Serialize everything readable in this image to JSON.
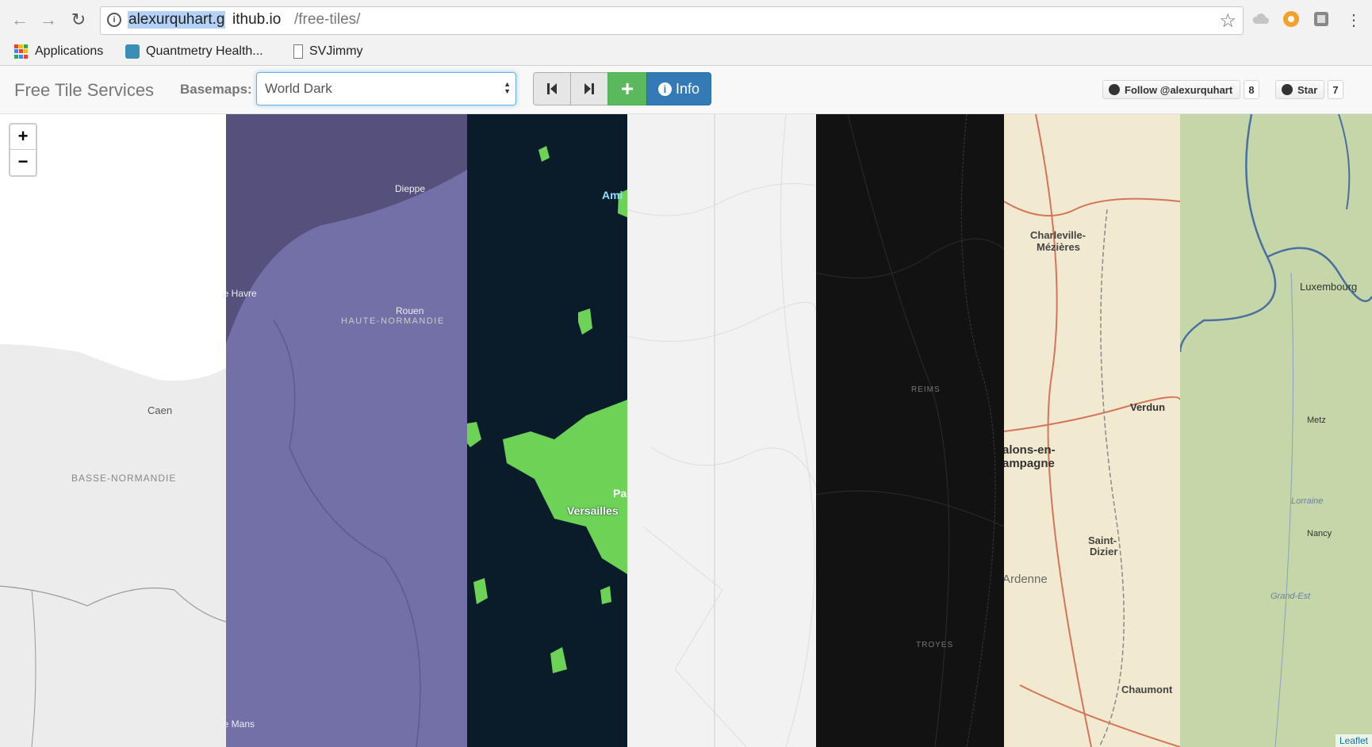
{
  "browser": {
    "url_host_highlight": "alexurquhart.g",
    "url_host_rest": "ithub.io",
    "url_path": "/free-tiles/",
    "bookmarks": [
      {
        "label": "Applications"
      },
      {
        "label": "Quantmetry Health..."
      },
      {
        "label": "SVJimmy"
      }
    ]
  },
  "header": {
    "title": "Free Tile Services",
    "basemaps_label": "Basemaps:",
    "basemap_selected": "World Dark",
    "info_label": "Info",
    "follow_label": "Follow @alexurquhart",
    "follow_count": "8",
    "star_label": "Star",
    "star_count": "7"
  },
  "map": {
    "zoom_in": "+",
    "zoom_out": "−",
    "attribution": "Leaflet",
    "strip1": {
      "labels": [
        "Caen",
        "BASSE-NORMANDIE"
      ]
    },
    "strip2": {
      "labels": [
        "Dieppe",
        "Le Havre",
        "Rouen",
        "HAUTE-NORMANDIE",
        "Le Mans"
      ]
    },
    "strip3": {
      "labels": [
        "Ami",
        "Versailles",
        "Pa"
      ]
    },
    "strip5": {
      "labels": [
        "REIMS",
        "TROYES"
      ]
    },
    "strip6": {
      "labels": [
        "Charleville-",
        "Mézières",
        "Verdun",
        "alons-en-",
        "ampagne",
        "Saint-",
        "Dizier",
        "Ardenne",
        "Chaumont"
      ]
    },
    "strip7": {
      "labels": [
        "Luxembourg",
        "Metz",
        "Lorraine",
        "Nancy",
        "Grand-Est"
      ]
    }
  },
  "colors": {
    "green_button": "#5cb85c",
    "blue_button": "#337ab7",
    "strip_purple": "#7370a7",
    "strip_navy": "#0a1c2a",
    "strip_green": "#6cd356",
    "strip_black": "#121212",
    "strip_topo": "#f1ead0",
    "strip_relief": "#c5d7a9"
  }
}
